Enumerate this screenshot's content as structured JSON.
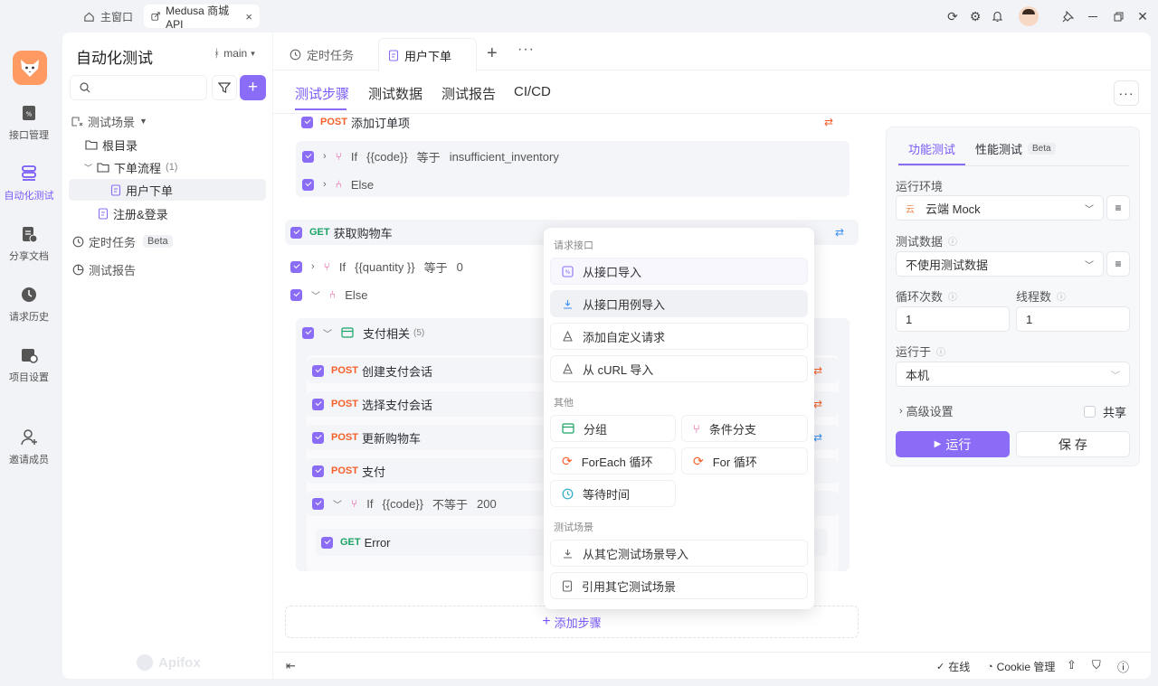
{
  "window": {
    "tabs": [
      {
        "label": "主窗口"
      },
      {
        "label": "Medusa 商城 API"
      }
    ]
  },
  "rail": [
    {
      "label": "接口管理"
    },
    {
      "label": "自动化测试"
    },
    {
      "label": "分享文档"
    },
    {
      "label": "请求历史"
    },
    {
      "label": "项目设置"
    },
    {
      "label": "邀请成员"
    }
  ],
  "tree": {
    "title": "自动化测试",
    "branch": "main",
    "search_placeholder": "",
    "items": [
      {
        "label": "测试场景"
      },
      {
        "label": "根目录"
      },
      {
        "label": "下单流程",
        "count": "(1)"
      },
      {
        "label": "用户下单"
      },
      {
        "label": "注册&登录"
      },
      {
        "label": "定时任务",
        "badge": "Beta"
      },
      {
        "label": "测试报告"
      }
    ],
    "watermark": "Apifox"
  },
  "doc_tabs": [
    {
      "label": "定时任务"
    },
    {
      "label": "用户下单"
    }
  ],
  "sub_tabs": [
    {
      "label": "测试步骤"
    },
    {
      "label": "测试数据"
    },
    {
      "label": "测试报告"
    },
    {
      "label": "CI/CD"
    }
  ],
  "steps": {
    "s1": {
      "method": "POST",
      "name": "添加订单项"
    },
    "s2": {
      "kw": "If",
      "left": "{{code}}",
      "op": "等于",
      "right": "insufficient_inventory"
    },
    "s3": {
      "kw": "Else"
    },
    "s4": {
      "method": "GET",
      "name": "获取购物车"
    },
    "s5": {
      "kw": "If",
      "left": "{{quantity }}",
      "op": "等于",
      "right": "0"
    },
    "s6": {
      "kw": "Else"
    },
    "s7": {
      "name": "支付相关",
      "count": "(5)"
    },
    "s8": {
      "method": "POST",
      "name": "创建支付会话"
    },
    "s9": {
      "method": "POST",
      "name": "选择支付会话"
    },
    "s10": {
      "method": "POST",
      "name": "更新购物车"
    },
    "s11": {
      "method": "POST",
      "name": "支付"
    },
    "s12": {
      "kw": "If",
      "left": "{{code}}",
      "op": "不等于",
      "right": "200"
    },
    "s13": {
      "method": "GET",
      "name": "Error"
    },
    "add_step": "添加步骤"
  },
  "popup": {
    "sec1": "请求接口",
    "i1": "从接口导入",
    "i2": "从接口用例导入",
    "i3": "添加自定义请求",
    "i4": "从 cURL 导入",
    "sec2": "其他",
    "i5": "分组",
    "i6": "条件分支",
    "i7": "ForEach 循环",
    "i8": "For 循环",
    "i9": "等待时间",
    "sec3": "测试场景",
    "i10": "从其它测试场景导入",
    "i11": "引用其它测试场景"
  },
  "config": {
    "tab1": "功能测试",
    "tab2": "性能测试",
    "tab2_badge": "Beta",
    "env_label": "运行环境",
    "env_value": "云端 Mock",
    "env_icon_text": "云",
    "data_label": "测试数据",
    "data_value": "不使用测试数据",
    "loop_label": "循环次数",
    "loop_value": "1",
    "thread_label": "线程数",
    "thread_value": "1",
    "runon_label": "运行于",
    "runon_value": "本机",
    "advanced": "高级设置",
    "share": "共享",
    "run": "运行",
    "save": "保 存"
  },
  "status": {
    "online": "在线",
    "cookie": "Cookie 管理"
  },
  "colors": {
    "accent": "#8b6cf6",
    "post": "#f5602a",
    "get": "#1aa365"
  }
}
